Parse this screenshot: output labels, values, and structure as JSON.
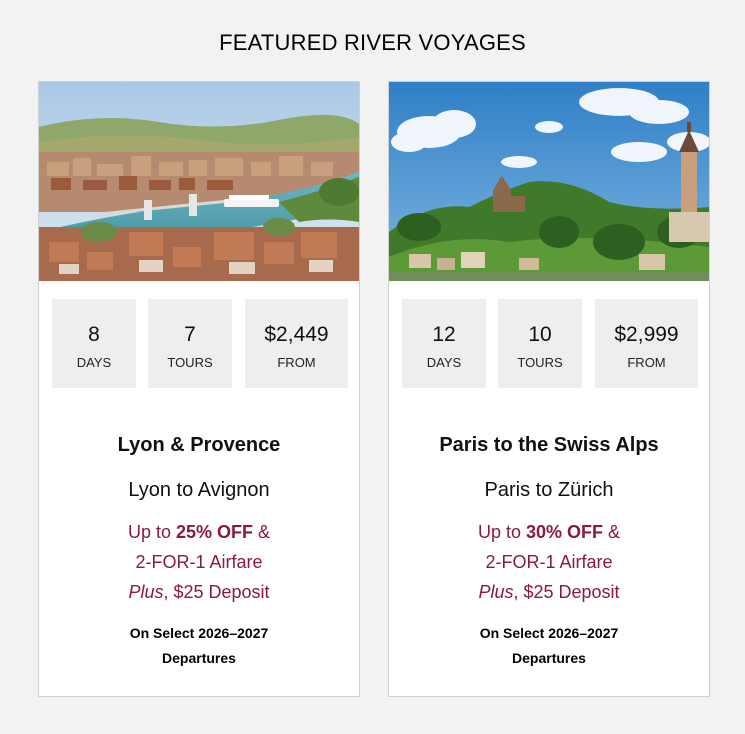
{
  "page": {
    "title": "FEATURED RIVER VOYAGES"
  },
  "colors": {
    "offer": "#8b1a3d",
    "stat_bg": "#eeeeee",
    "page_bg": "#f2f2f2"
  },
  "cards": [
    {
      "image": "lyon-river-town-photo",
      "stats": [
        {
          "value": "8",
          "label": "DAYS"
        },
        {
          "value": "7",
          "label": "TOURS"
        },
        {
          "value": "$2,449",
          "label": "FROM"
        }
      ],
      "name": "Lyon & Provence",
      "route": "Lyon to Avignon",
      "offer": {
        "prefix": "Up to ",
        "discount": "25% OFF",
        "suffix": " &",
        "line2": "2-FOR-1 Airfare",
        "plus": "Plus",
        "deposit": ", $25 Deposit"
      },
      "note_line1": "On Select 2026–2027",
      "note_line2": "Departures"
    },
    {
      "image": "swiss-castle-village-photo",
      "stats": [
        {
          "value": "12",
          "label": "DAYS"
        },
        {
          "value": "10",
          "label": "TOURS"
        },
        {
          "value": "$2,999",
          "label": "FROM"
        }
      ],
      "name": "Paris to the Swiss Alps",
      "route": "Paris to Zürich",
      "offer": {
        "prefix": "Up to ",
        "discount": "30% OFF",
        "suffix": " &",
        "line2": "2-FOR-1 Airfare",
        "plus": "Plus",
        "deposit": ", $25 Deposit"
      },
      "note_line1": "On Select 2026–2027",
      "note_line2": "Departures"
    }
  ]
}
